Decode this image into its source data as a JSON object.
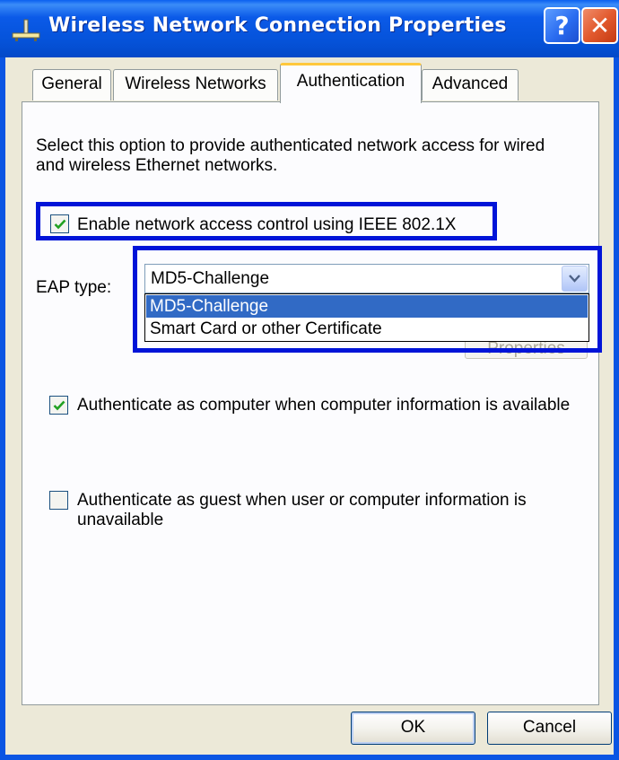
{
  "window": {
    "title": "Wireless Network Connection Properties",
    "help_glyph": "?",
    "close_glyph": "✕"
  },
  "tabs": [
    {
      "label": "General"
    },
    {
      "label": "Wireless Networks"
    },
    {
      "label": "Authentication",
      "active": true
    },
    {
      "label": "Advanced"
    }
  ],
  "panel": {
    "description": "Select this option to provide authenticated network access for wired and wireless Ethernet networks.",
    "enable_8021x": {
      "label": "Enable network access control using IEEE 802.1X",
      "checked": true
    },
    "eap": {
      "label": "EAP type:",
      "selected": "MD5-Challenge",
      "options": [
        "MD5-Challenge",
        "Smart Card or other Certificate"
      ]
    },
    "properties_button": "Properties",
    "auth_computer": {
      "label": "Authenticate as computer when computer information is available",
      "checked": true
    },
    "auth_guest": {
      "label": "Authenticate as guest when user or computer information is unavailable",
      "checked": false
    }
  },
  "buttons": {
    "ok": "OK",
    "cancel": "Cancel"
  },
  "colors": {
    "titlebar": "#0553da",
    "highlight_box": "#0014d8",
    "selection": "#316ac5",
    "dialog_bg": "#ece9d8",
    "check_green": "#21a121"
  }
}
